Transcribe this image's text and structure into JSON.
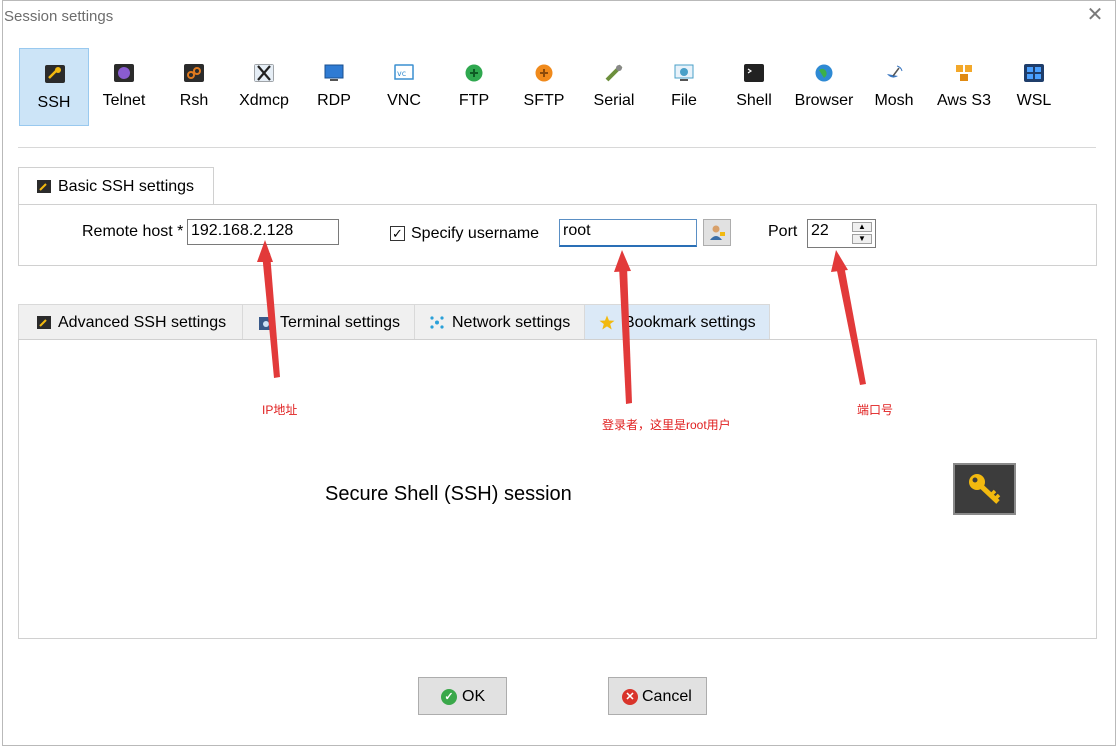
{
  "window": {
    "title": "Session settings",
    "close_glyph": "✕"
  },
  "session_types": [
    {
      "label": "SSH",
      "icon": "key-icon",
      "color": "#2b2b2b",
      "selected": true
    },
    {
      "label": "Telnet",
      "icon": "telnet-icon",
      "color": "#7b4fb8"
    },
    {
      "label": "Rsh",
      "icon": "rsh-icon",
      "color": "#e07a1f"
    },
    {
      "label": "Xdmcp",
      "icon": "x-icon",
      "color": "#5a5a5a"
    },
    {
      "label": "RDP",
      "icon": "rdp-icon",
      "color": "#2f7bd3"
    },
    {
      "label": "VNC",
      "icon": "vnc-icon",
      "color": "#3a8fd0"
    },
    {
      "label": "FTP",
      "icon": "ftp-icon",
      "color": "#2fa84f"
    },
    {
      "label": "SFTP",
      "icon": "sftp-icon",
      "color": "#f08a1c"
    },
    {
      "label": "Serial",
      "icon": "serial-icon",
      "color": "#6c8f3c"
    },
    {
      "label": "File",
      "icon": "file-icon",
      "color": "#4aa0c8"
    },
    {
      "label": "Shell",
      "icon": "shell-icon",
      "color": "#222222"
    },
    {
      "label": "Browser",
      "icon": "globe-icon",
      "color": "#2e8ad4"
    },
    {
      "label": "Mosh",
      "icon": "satellite-icon",
      "color": "#3b78c2"
    },
    {
      "label": "Aws S3",
      "icon": "aws-icon",
      "color": "#f3a82a"
    },
    {
      "label": "WSL",
      "icon": "windows-icon",
      "color": "#2f6fc4"
    }
  ],
  "basic": {
    "tab_label": "Basic SSH settings",
    "remote_host_label": "Remote host *",
    "remote_host_value": "192.168.2.128",
    "specify_username_label": "Specify username",
    "specify_username_checked": true,
    "check_glyph": "✓",
    "username_value": "root",
    "port_label": "Port",
    "port_value": "22",
    "spin_up": "▲",
    "spin_down": "▼"
  },
  "tabs": [
    {
      "label": "Advanced SSH settings",
      "icon": "key-icon",
      "color": "#2b2b2b"
    },
    {
      "label": "Terminal settings",
      "icon": "terminal-icon",
      "color": "#3a5a8a"
    },
    {
      "label": "Network settings",
      "icon": "network-icon",
      "color": "#2aa0d8"
    },
    {
      "label": "Bookmark settings",
      "icon": "star-icon",
      "color": "#f2b90f",
      "selected": true
    }
  ],
  "panel": {
    "description": "Secure Shell (SSH) session"
  },
  "annotations": {
    "ip": "IP地址",
    "user": "登录者，这里是root用户",
    "port": "端口号",
    "color": "#e02020"
  },
  "buttons": {
    "ok_label": "OK",
    "ok_glyph": "✓",
    "cancel_label": "Cancel",
    "cancel_glyph": "✕"
  }
}
